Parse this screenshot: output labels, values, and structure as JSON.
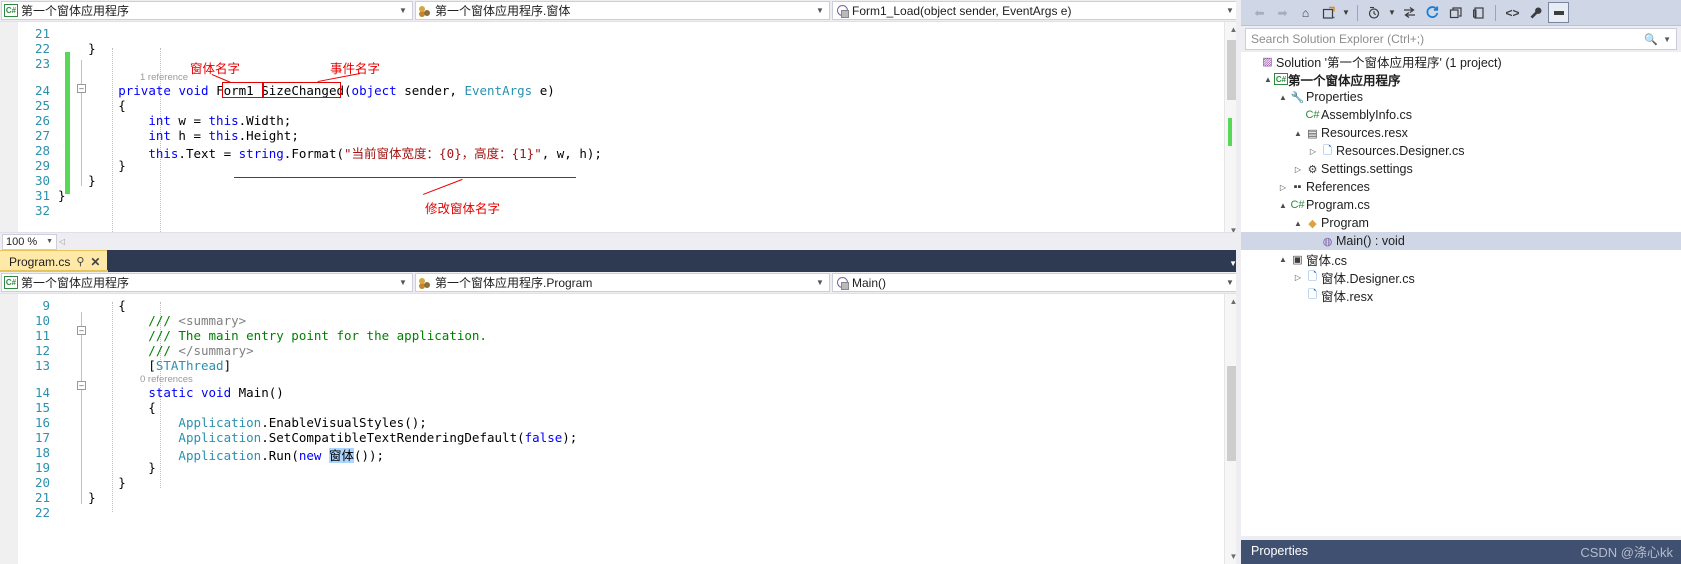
{
  "nav_top": {
    "project_combo": {
      "icon": "csharp-icon",
      "value": "第一个窗体应用程序"
    },
    "class_combo": {
      "icon": "class-icon",
      "value": "第一个窗体应用程序.窗体"
    },
    "member_combo": {
      "icon": "method-icon",
      "value": "Form1_Load(object sender, EventArgs e)"
    }
  },
  "editor_top": {
    "zoom_level": "100 %",
    "code_lines": [
      {
        "num": "21",
        "text": "",
        "tokens": []
      },
      {
        "num": "22",
        "text": "    }",
        "tokens": [
          {
            "t": "    }",
            "c": "plain"
          }
        ]
      },
      {
        "num": "23",
        "text": "",
        "tokens": []
      },
      {
        "num": "24",
        "text": "private void Form1_SizeChanged(object sender, EventArgs e)",
        "tokens": [
          {
            "t": "        ",
            "c": "plain"
          },
          {
            "t": "private",
            "c": "kw"
          },
          {
            "t": " ",
            "c": "plain"
          },
          {
            "t": "void",
            "c": "kw"
          },
          {
            "t": " Form1_SizeChanged(",
            "c": "plain"
          },
          {
            "t": "object",
            "c": "kw"
          },
          {
            "t": " sender, ",
            "c": "plain"
          },
          {
            "t": "EventArgs",
            "c": "ty"
          },
          {
            "t": " e)",
            "c": "plain"
          }
        ]
      },
      {
        "num": "25",
        "text": "        {",
        "tokens": [
          {
            "t": "        {",
            "c": "plain"
          }
        ]
      },
      {
        "num": "26",
        "text": "int w = this.Width;",
        "tokens": [
          {
            "t": "            ",
            "c": "plain"
          },
          {
            "t": "int",
            "c": "kw"
          },
          {
            "t": " w = ",
            "c": "plain"
          },
          {
            "t": "this",
            "c": "kw"
          },
          {
            "t": ".Width;",
            "c": "plain"
          }
        ]
      },
      {
        "num": "27",
        "text": "int h = this.Height;",
        "tokens": [
          {
            "t": "            ",
            "c": "plain"
          },
          {
            "t": "int",
            "c": "kw"
          },
          {
            "t": " h = ",
            "c": "plain"
          },
          {
            "t": "this",
            "c": "kw"
          },
          {
            "t": ".Height;",
            "c": "plain"
          }
        ]
      },
      {
        "num": "28",
        "text": "this.Text = string.Format(\"当前窗体宽度：{0}，高度：{1}\", w, h);",
        "tokens": [
          {
            "t": "            ",
            "c": "plain"
          },
          {
            "t": "this",
            "c": "kw"
          },
          {
            "t": ".Text = ",
            "c": "plain"
          },
          {
            "t": "string",
            "c": "kw"
          },
          {
            "t": ".Format(",
            "c": "plain"
          },
          {
            "t": "\"当前窗体宽度：{0}，高度：{1}\"",
            "c": "st"
          },
          {
            "t": ", w, h);",
            "c": "plain"
          }
        ]
      },
      {
        "num": "29",
        "text": "        }",
        "tokens": [
          {
            "t": "        }",
            "c": "plain"
          }
        ]
      },
      {
        "num": "30",
        "text": "    }",
        "tokens": [
          {
            "t": "    }",
            "c": "plain"
          }
        ]
      },
      {
        "num": "31",
        "text": "}",
        "tokens": [
          {
            "t": "}",
            "c": "plain"
          }
        ]
      },
      {
        "num": "32",
        "text": "",
        "tokens": []
      }
    ],
    "codelens": "1 reference",
    "annotations": [
      {
        "name": "form-name-annotation",
        "label": "窗体名字"
      },
      {
        "name": "event-name-annotation",
        "label": "事件名字"
      },
      {
        "name": "modify-form-name-annotation",
        "label": "修改窗体名字"
      }
    ]
  },
  "tab_bar": {
    "tabs": [
      {
        "label": "Program.cs",
        "pin": "⚲",
        "close": "✕",
        "active": true
      }
    ]
  },
  "nav_bottom": {
    "project_combo": {
      "icon": "csharp-icon",
      "value": "第一个窗体应用程序"
    },
    "class_combo": {
      "icon": "class-icon",
      "value": "第一个窗体应用程序.Program"
    },
    "member_combo": {
      "icon": "method-icon",
      "value": "Main()"
    }
  },
  "editor_bottom": {
    "code_lines": [
      {
        "num": "9",
        "tokens": [
          {
            "t": "        {",
            "c": "plain"
          }
        ]
      },
      {
        "num": "10",
        "tokens": [
          {
            "t": "            /// ",
            "c": "cm"
          },
          {
            "t": "<summary>",
            "c": "cmx"
          }
        ]
      },
      {
        "num": "11",
        "tokens": [
          {
            "t": "            /// The main entry point for the application.",
            "c": "cm"
          }
        ]
      },
      {
        "num": "12",
        "tokens": [
          {
            "t": "            /// ",
            "c": "cm"
          },
          {
            "t": "</summary>",
            "c": "cmx"
          }
        ]
      },
      {
        "num": "13",
        "tokens": [
          {
            "t": "            [",
            "c": "plain"
          },
          {
            "t": "STAThread",
            "c": "ty"
          },
          {
            "t": "]",
            "c": "plain"
          }
        ]
      },
      {
        "num": "14",
        "tokens": [
          {
            "t": "            ",
            "c": "plain"
          },
          {
            "t": "static",
            "c": "kw"
          },
          {
            "t": " ",
            "c": "plain"
          },
          {
            "t": "void",
            "c": "kw"
          },
          {
            "t": " Main()",
            "c": "plain"
          }
        ]
      },
      {
        "num": "15",
        "tokens": [
          {
            "t": "            {",
            "c": "plain"
          }
        ]
      },
      {
        "num": "16",
        "tokens": [
          {
            "t": "                ",
            "c": "plain"
          },
          {
            "t": "Application",
            "c": "ty"
          },
          {
            "t": ".EnableVisualStyles();",
            "c": "plain"
          }
        ]
      },
      {
        "num": "17",
        "tokens": [
          {
            "t": "                ",
            "c": "plain"
          },
          {
            "t": "Application",
            "c": "ty"
          },
          {
            "t": ".SetCompatibleTextRenderingDefault(",
            "c": "plain"
          },
          {
            "t": "false",
            "c": "kw"
          },
          {
            "t": ");",
            "c": "plain"
          }
        ]
      },
      {
        "num": "18",
        "tokens": [
          {
            "t": "                ",
            "c": "plain"
          },
          {
            "t": "Application",
            "c": "ty"
          },
          {
            "t": ".Run(",
            "c": "plain"
          },
          {
            "t": "new",
            "c": "kw"
          },
          {
            "t": " ",
            "c": "plain"
          },
          {
            "t": "窗体",
            "c": "sel"
          },
          {
            "t": "());",
            "c": "plain"
          }
        ]
      },
      {
        "num": "19",
        "tokens": [
          {
            "t": "            }",
            "c": "plain"
          }
        ]
      },
      {
        "num": "20",
        "tokens": [
          {
            "t": "        }",
            "c": "plain"
          }
        ]
      },
      {
        "num": "21",
        "tokens": [
          {
            "t": "    }",
            "c": "plain"
          }
        ]
      },
      {
        "num": "22",
        "tokens": []
      }
    ],
    "codelens": "0 references"
  },
  "solution_explorer": {
    "toolbar_icons": [
      "back-arrow-icon",
      "forward-arrow-icon",
      "home-icon",
      "pending-changes-icon",
      "toolbar-dropdown-icon",
      "sync-with-active-document-icon",
      "refresh-icon",
      "collapse-all-icon",
      "show-all-files-icon",
      "view-code-icon",
      "properties-wrench-icon",
      "preview-pane-icon"
    ],
    "search": {
      "placeholder": "Search Solution Explorer (Ctrl+;)",
      "value": "",
      "icon": "search-icon",
      "dropdown_icon": "chevron-down-icon"
    },
    "tree": [
      {
        "depth": 0,
        "twist": "",
        "icon": "solution-icon",
        "label": "Solution '第一个窗体应用程序' (1 project)",
        "bold": false,
        "selected": false
      },
      {
        "depth": 1,
        "twist": "▲",
        "icon": "csharp-project-icon",
        "label": "第一个窗体应用程序",
        "bold": true,
        "selected": false
      },
      {
        "depth": 2,
        "twist": "▲",
        "icon": "properties-wrench-icon",
        "label": "Properties",
        "bold": false,
        "selected": false
      },
      {
        "depth": 3,
        "twist": "",
        "icon": "csharp-file-icon",
        "label": "AssemblyInfo.cs",
        "bold": false,
        "selected": false
      },
      {
        "depth": 3,
        "twist": "▲",
        "icon": "resx-icon",
        "label": "Resources.resx",
        "bold": false,
        "selected": false
      },
      {
        "depth": 4,
        "twist": "▷",
        "icon": "designer-file-icon",
        "label": "Resources.Designer.cs",
        "bold": false,
        "selected": false
      },
      {
        "depth": 3,
        "twist": "▷",
        "icon": "settings-gear-icon",
        "label": "Settings.settings",
        "bold": false,
        "selected": false
      },
      {
        "depth": 2,
        "twist": "▷",
        "icon": "references-icon",
        "label": "References",
        "bold": false,
        "selected": false
      },
      {
        "depth": 2,
        "twist": "▲",
        "icon": "csharp-file-icon",
        "label": "Program.cs",
        "bold": false,
        "selected": false
      },
      {
        "depth": 3,
        "twist": "▲",
        "icon": "class-icon",
        "label": "Program",
        "bold": false,
        "selected": false
      },
      {
        "depth": 4,
        "twist": "",
        "icon": "method-icon",
        "label": "Main() : void",
        "bold": false,
        "selected": true
      },
      {
        "depth": 2,
        "twist": "▲",
        "icon": "form-icon",
        "label": "窗体.cs",
        "bold": false,
        "selected": false
      },
      {
        "depth": 3,
        "twist": "▷",
        "icon": "designer-file-icon",
        "label": "窗体.Designer.cs",
        "bold": false,
        "selected": false
      },
      {
        "depth": 3,
        "twist": "",
        "icon": "designer-file-icon",
        "label": "窗体.resx",
        "bold": false,
        "selected": false
      }
    ],
    "properties_panel": {
      "title": "Properties"
    },
    "watermark": "CSDN @涤心kk"
  },
  "colors": {
    "accent_blue": "#3f5070",
    "tab_active": "#ffe9a8",
    "keyword": "#0000ff",
    "type": "#2b91af",
    "string": "#a31515",
    "comment": "#008000",
    "annotation_red": "#e60000",
    "change_bar_green": "#57d957",
    "selection_blue": "#add6ff"
  }
}
